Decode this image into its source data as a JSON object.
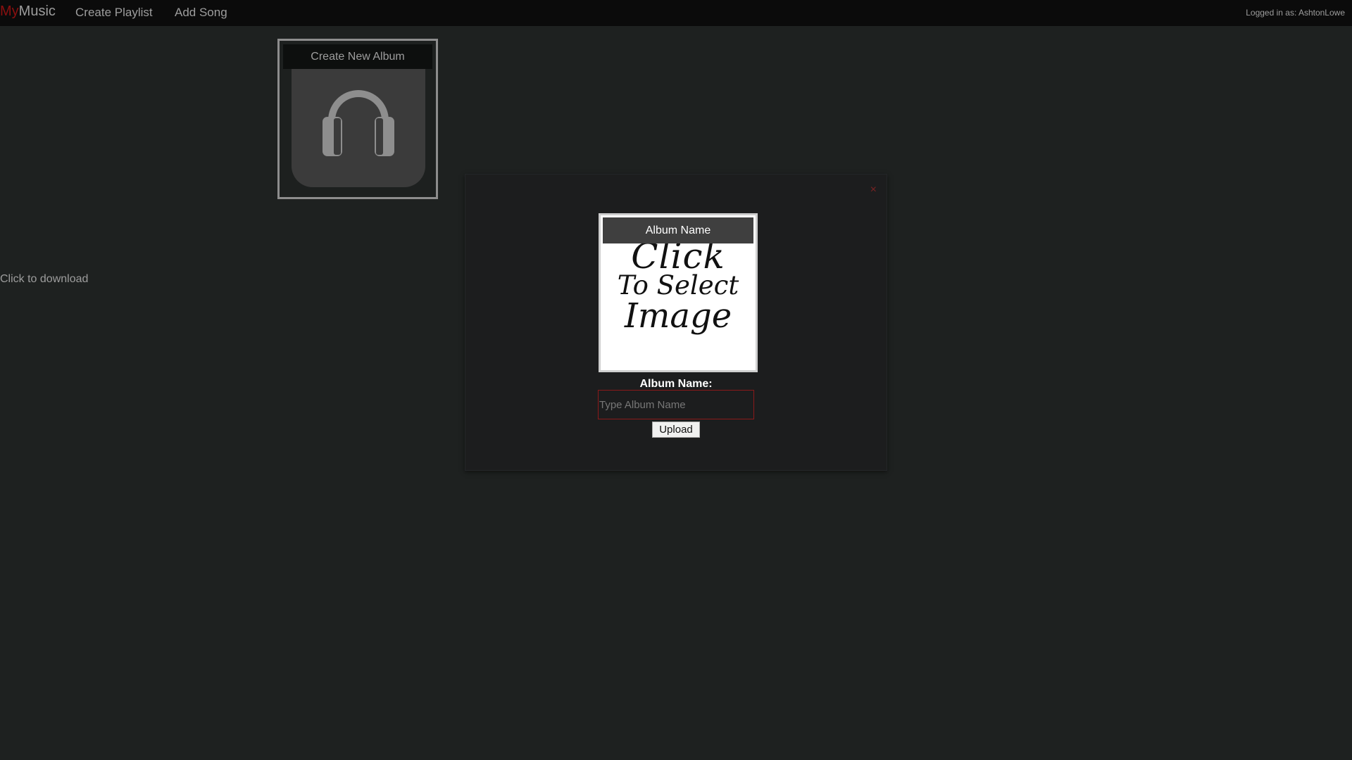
{
  "navbar": {
    "brand_prefix": "My",
    "brand_suffix": "Music",
    "links": [
      "Create Playlist",
      "Add Song"
    ],
    "logged_in_text": "Logged in as: AshtonLowe"
  },
  "album_card": {
    "title": "Create New Album",
    "icon": "headphones-icon"
  },
  "download_text": "Click to download",
  "modal": {
    "close_symbol": "×",
    "image_picker": {
      "title": "Album Name",
      "prompt_lines": [
        "Click",
        "To Select",
        "Image"
      ]
    },
    "field_label": "Album Name:",
    "input_value": "",
    "input_placeholder": "Type Album Name",
    "upload_label": "Upload"
  },
  "colors": {
    "page_bg": "#1e2120",
    "navbar_bg": "#0b0b0b",
    "brand_accent": "#8b1010",
    "modal_bg": "#1c1d1e",
    "input_border": "#8b1a1a"
  }
}
